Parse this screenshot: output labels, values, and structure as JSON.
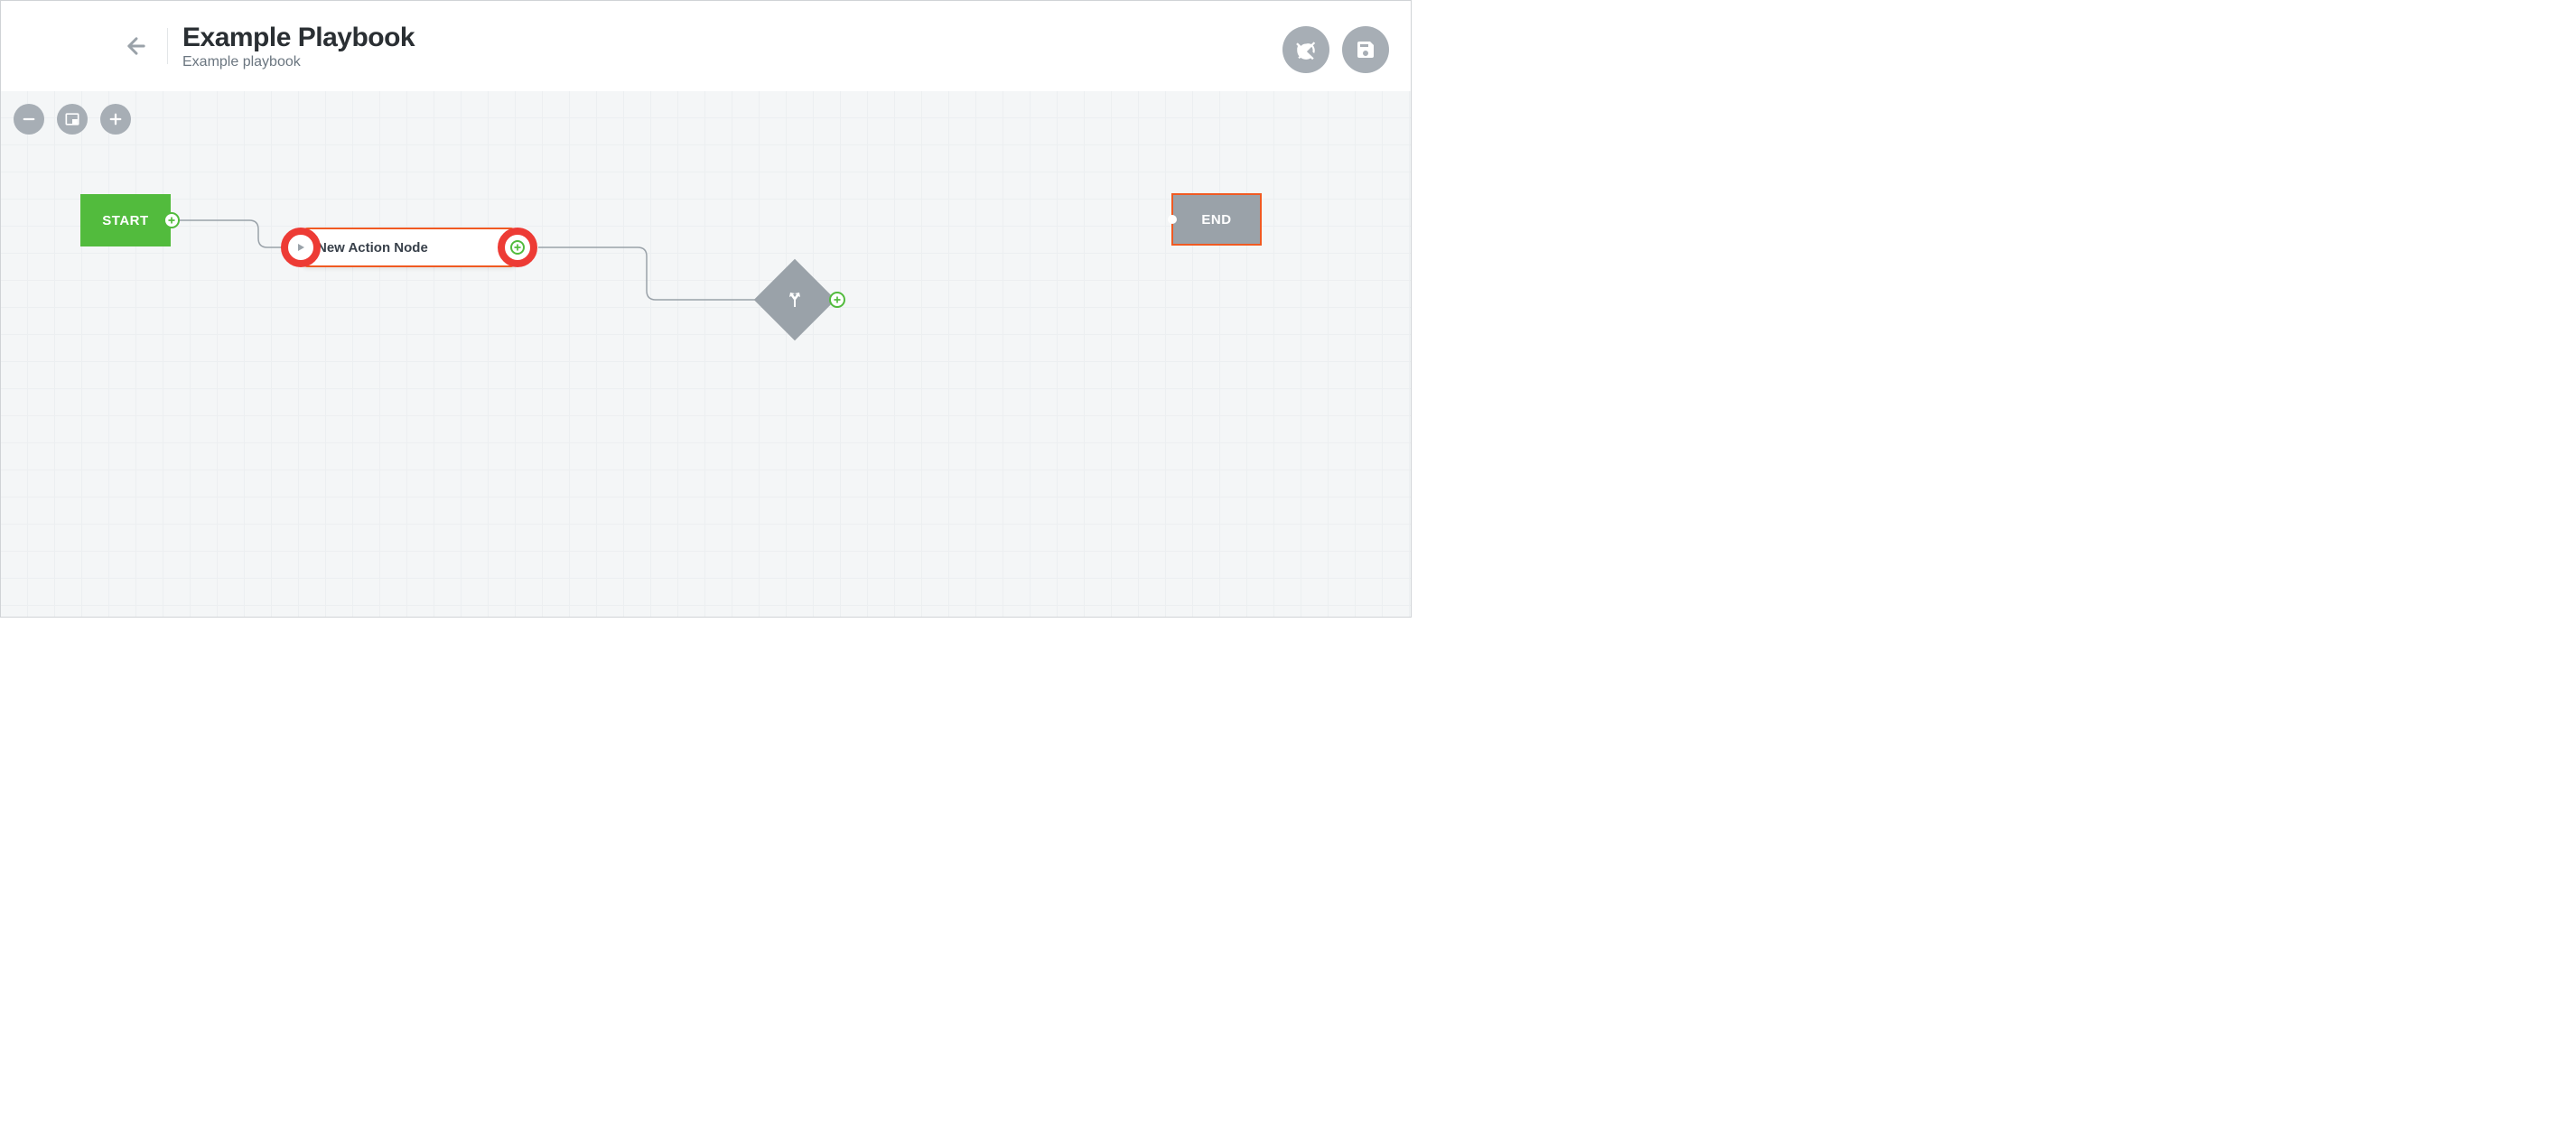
{
  "header": {
    "title": "Example Playbook",
    "subtitle": "Example playbook",
    "actions": {
      "alarm_off": "alarm-off",
      "save": "save"
    }
  },
  "zoom": {
    "out": "zoom-out",
    "fit": "zoom-fit",
    "in": "zoom-in"
  },
  "nodes": {
    "start": {
      "label": "START",
      "icon": "plus"
    },
    "action": {
      "label": "New Action Node",
      "in_icon": "play",
      "out_icon": "plus"
    },
    "decision": {
      "icon": "split-arrows",
      "out_icon": "plus"
    },
    "end": {
      "label": "END"
    }
  },
  "colors": {
    "accent_orange": "#f05a22",
    "accent_green": "#52bb3d",
    "accent_red": "#ed3b35",
    "muted_gray": "#9aa2a9",
    "grid_bg": "#f4f6f7"
  }
}
